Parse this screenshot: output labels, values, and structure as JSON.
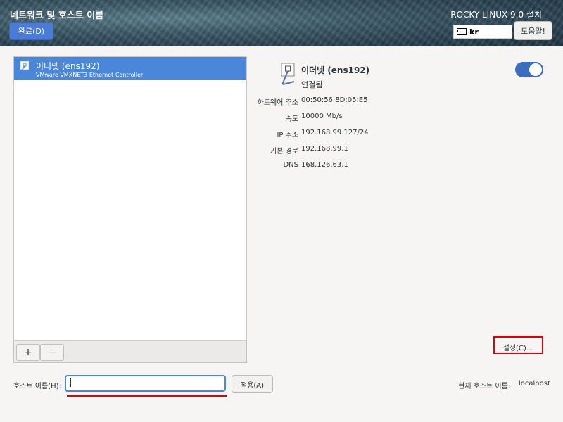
{
  "header": {
    "title": "네트워크 및 호스트 이름",
    "done_label": "완료(D)",
    "product": "ROCKY LINUX 9.0 설치",
    "keyboard_layout": "kr",
    "help_label": "도움말!"
  },
  "device_list": {
    "items": [
      {
        "name": "이더넷 (ens192)",
        "description": "VMware VMXNET3 Ethernet Controller"
      }
    ],
    "add_label": "+",
    "remove_label": "−"
  },
  "device": {
    "name": "이더넷 (ens192)",
    "status": "연결됨",
    "enabled": true,
    "details": [
      {
        "label": "하드웨어 주소",
        "value": "00:50:56:8D:05:E5"
      },
      {
        "label": "속도",
        "value": "10000 Mb/s"
      },
      {
        "label": "IP 주소",
        "value": "192.168.99.127/24"
      },
      {
        "label": "기본 경로",
        "value": "192.168.99.1"
      },
      {
        "label": "DNS",
        "value": "168.126.63.1"
      }
    ],
    "settings_label": "설정(C)..."
  },
  "hostname": {
    "label": "호스트 이름(H):",
    "value": "",
    "apply_label": "적용(A)",
    "current_label": "현재 호스트 이름:",
    "current_value": "localhost"
  },
  "colors": {
    "accent": "#4a86d9",
    "highlight": "#e0000a"
  }
}
